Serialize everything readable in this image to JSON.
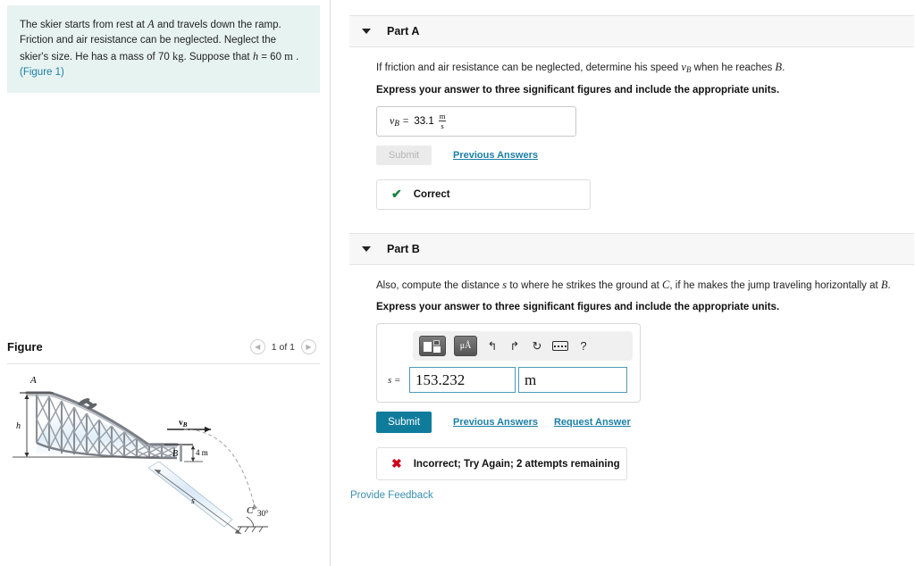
{
  "problem": {
    "text_1": "The skier starts from rest at ",
    "var_A": "A",
    "text_2": " and travels down the ramp. Friction and air resistance can be neglected. Neglect the skier's size. He has a mass of 70 ",
    "unit_kg": "kg",
    "text_3": ". Suppose that ",
    "var_h": "h",
    "text_4": " = 60  ",
    "unit_m": "m",
    "text_5": " . ",
    "figure_link": "(Figure 1)"
  },
  "figure_panel": {
    "title": "Figure",
    "prev_icon": "chevron-left-icon",
    "next_icon": "chevron-right-icon",
    "counter": "1 of 1",
    "diagram": {
      "label_A": "A",
      "label_B": "B",
      "label_C": "C",
      "label_h": "h",
      "label_vB": "v",
      "label_vB_sub": "B",
      "label_4m": "4 m",
      "label_s": "s",
      "label_angle": "30°"
    }
  },
  "part_a": {
    "caret_icon": "caret-down-icon",
    "label": "Part A",
    "question_pre": "If friction and air resistance can be neglected, determine his speed ",
    "question_var": "v",
    "question_var_sub": "B",
    "question_mid": " when he reaches ",
    "question_var2": "B",
    "question_post": ".",
    "instruction": "Express your answer to three significant figures and include the appropriate units.",
    "answer_var": "v",
    "answer_var_sub": "B",
    "answer_eq": "=",
    "answer_value": "33.1",
    "answer_unit_num": "m",
    "answer_unit_den": "s",
    "submit_label": "Submit",
    "previous_answers_label": "Previous Answers",
    "feedback_icon": "check-icon",
    "feedback_text": "Correct"
  },
  "part_b": {
    "caret_icon": "caret-down-icon",
    "label": "Part B",
    "question_pre": "Also, compute the distance ",
    "question_var": "s",
    "question_mid": " to where he strikes the ground at ",
    "question_var2": "C",
    "question_mid2": ", if he makes the jump traveling horizontally at ",
    "question_var3": "B",
    "question_post": ".",
    "instruction": "Express your answer to three significant figures and include the appropriate units.",
    "toolbar": {
      "template_icon": "math-template-icon",
      "units_icon": "micro-angstrom-units-icon",
      "units_label": "μÅ",
      "undo_icon": "undo-icon",
      "undo_glyph": "↰",
      "redo_icon": "redo-icon",
      "redo_glyph": "↱",
      "reset_icon": "reset-icon",
      "reset_glyph": "↻",
      "keyboard_icon": "keyboard-icon",
      "help_icon": "help-icon",
      "help_glyph": "?"
    },
    "entry_var": "s =",
    "entry_value": "153.232",
    "entry_unit": "m",
    "submit_label": "Submit",
    "previous_answers_label": "Previous Answers",
    "request_answer_label": "Request Answer",
    "feedback_icon": "cross-icon",
    "feedback_text": "Incorrect; Try Again; 2 attempts remaining"
  },
  "footer": {
    "provide_feedback_label": "Provide Feedback"
  },
  "colors": {
    "problem_bg": "#e7f3f1",
    "link": "#1b7fa8",
    "submit_bg": "#0f7c9c",
    "correct": "#17823f",
    "incorrect": "#d0021b",
    "input_border": "#4d9ab5"
  }
}
